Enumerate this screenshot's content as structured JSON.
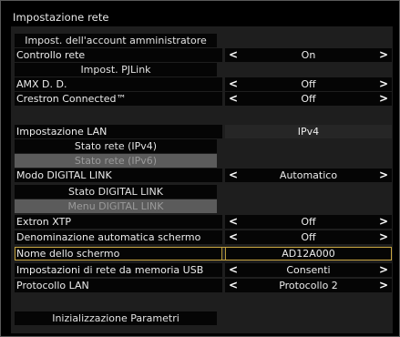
{
  "title": "Impostazione rete",
  "items": {
    "admin_account": "Impost. dell'account amministratore",
    "network_control": {
      "label": "Controllo rete",
      "value": "On"
    },
    "pjlink": "Impost. PJLink",
    "amx_dd": {
      "label": "AMX D. D.",
      "value": "Off"
    },
    "crestron": {
      "label": "Crestron Connected™",
      "value": "Off"
    },
    "lan_setting": {
      "label": "Impostazione LAN",
      "value": "IPv4"
    },
    "net_status_ipv4": "Stato rete (IPv4)",
    "net_status_ipv6": "Stato rete (IPv6)",
    "digital_link_mode": {
      "label": "Modo DIGITAL LINK",
      "value": "Automatico"
    },
    "digital_link_status": "Stato DIGITAL LINK",
    "digital_link_menu": "Menu DIGITAL LINK",
    "extron_xtp": {
      "label": "Extron XTP",
      "value": "Off"
    },
    "auto_screen_name": {
      "label": "Denominazione automatica schermo",
      "value": "Off"
    },
    "screen_name": {
      "label": "Nome dello schermo",
      "value": "AD12A000"
    },
    "usb_network_settings": {
      "label": "Impostazioni di rete da memoria USB",
      "value": "Consenti"
    },
    "lan_protocol": {
      "label": "Protocollo LAN",
      "value": "Protocollo 2"
    },
    "init_params": "Inizializzazione Parametri"
  },
  "arrows": {
    "left": "<",
    "right": ">"
  },
  "colors": {
    "highlight_border": "#c9a640",
    "disabled_bg": "#5b5b5b",
    "panel_bg": "#1e1e1e"
  }
}
